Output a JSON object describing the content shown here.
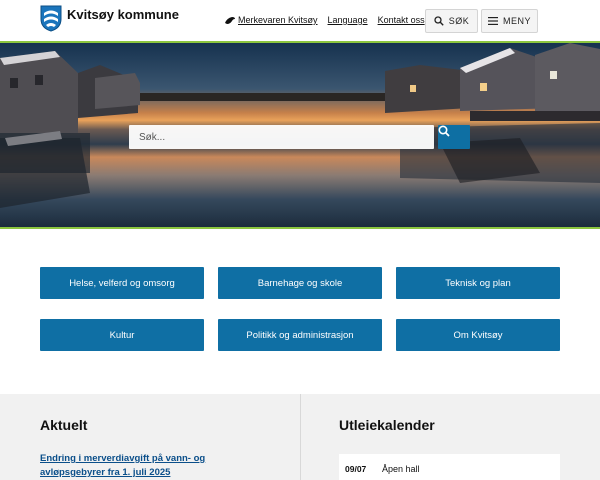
{
  "header": {
    "brand": "Kvitsøy kommune",
    "links": {
      "merkevaren": "Merkevaren Kvitsøy",
      "language": "Language",
      "kontakt": "Kontakt oss"
    },
    "search_button": "SØK",
    "menu_button": "MENY"
  },
  "hero": {
    "search_placeholder": "Søk..."
  },
  "categories": [
    "Helse, velferd og omsorg",
    "Barnehage og skole",
    "Teknisk og plan",
    "Kultur",
    "Politikk og administrasjon",
    "Om Kvitsøy"
  ],
  "aktuelt": {
    "title": "Aktuelt",
    "news": [
      "Endring i merverdiavgift på vann- og avløpsgebyrer fra 1. juli 2025"
    ]
  },
  "utleie": {
    "title": "Utleiekalender",
    "events": [
      {
        "date": "09/07",
        "name": "Åpen hall"
      }
    ]
  },
  "colors": {
    "primary": "#0f6fa4",
    "accent_green": "#8cc63f",
    "link": "#0b4f8a"
  }
}
